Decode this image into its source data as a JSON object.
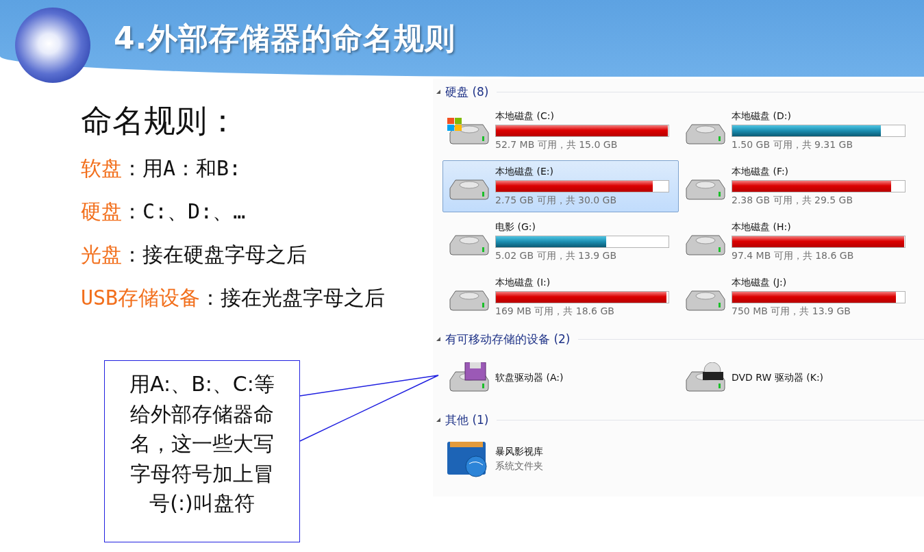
{
  "slide": {
    "title": "4.外部存储器的命名规则",
    "heading": "命名规则：",
    "rules": [
      {
        "term": "软盘",
        "text": "：用A：和B:"
      },
      {
        "term": "硬盘",
        "text": "：C:、D:、…"
      },
      {
        "term": "光盘",
        "text": "：接在硬盘字母之后"
      },
      {
        "term": "USB存储设备",
        "text": "：接在光盘字母之后"
      }
    ],
    "callout": "用A:、B:、C:等给外部存储器命名，这一些大写字母符号加上冒号(:)叫盘符"
  },
  "explorer": {
    "sections": [
      {
        "title": "硬盘 (8)",
        "expanded": true,
        "items": [
          {
            "kind": "system-disk",
            "name": "本地磁盘 (C:)",
            "level": 0.997,
            "info": "52.7 MB 可用，共 15.0 GB",
            "selected": false
          },
          {
            "kind": "disk",
            "name": "本地磁盘 (D:)",
            "level": 0.86,
            "info": "1.50 GB 可用，共 9.31 GB",
            "selected": false
          },
          {
            "kind": "disk",
            "name": "本地磁盘 (E:)",
            "level": 0.91,
            "info": "2.75 GB 可用，共 30.0 GB",
            "selected": true
          },
          {
            "kind": "disk",
            "name": "本地磁盘 (F:)",
            "level": 0.92,
            "info": "2.38 GB 可用，共 29.5 GB",
            "selected": false
          },
          {
            "kind": "disk",
            "name": "电影 (G:)",
            "level": 0.64,
            "info": "5.02 GB 可用，共 13.9 GB",
            "selected": false
          },
          {
            "kind": "disk",
            "name": "本地磁盘 (H:)",
            "level": 0.995,
            "info": "97.4 MB 可用，共 18.6 GB",
            "selected": false
          },
          {
            "kind": "disk",
            "name": "本地磁盘 (I:)",
            "level": 0.99,
            "info": "169 MB 可用，共 18.6 GB",
            "selected": false
          },
          {
            "kind": "disk",
            "name": "本地磁盘 (J:)",
            "level": 0.95,
            "info": "750 MB 可用，共 13.9 GB",
            "selected": false
          }
        ]
      },
      {
        "title": "有可移动存储的设备 (2)",
        "expanded": true,
        "items": [
          {
            "kind": "floppy",
            "name": "软盘驱动器 (A:)",
            "selected": false
          },
          {
            "kind": "dvd",
            "name": "DVD RW 驱动器 (K:)",
            "selected": false
          }
        ]
      },
      {
        "title": "其他 (1)",
        "expanded": true,
        "items": [
          {
            "kind": "folder",
            "name": "暴风影视库",
            "info": "系统文件夹",
            "selected": false
          }
        ]
      }
    ]
  }
}
